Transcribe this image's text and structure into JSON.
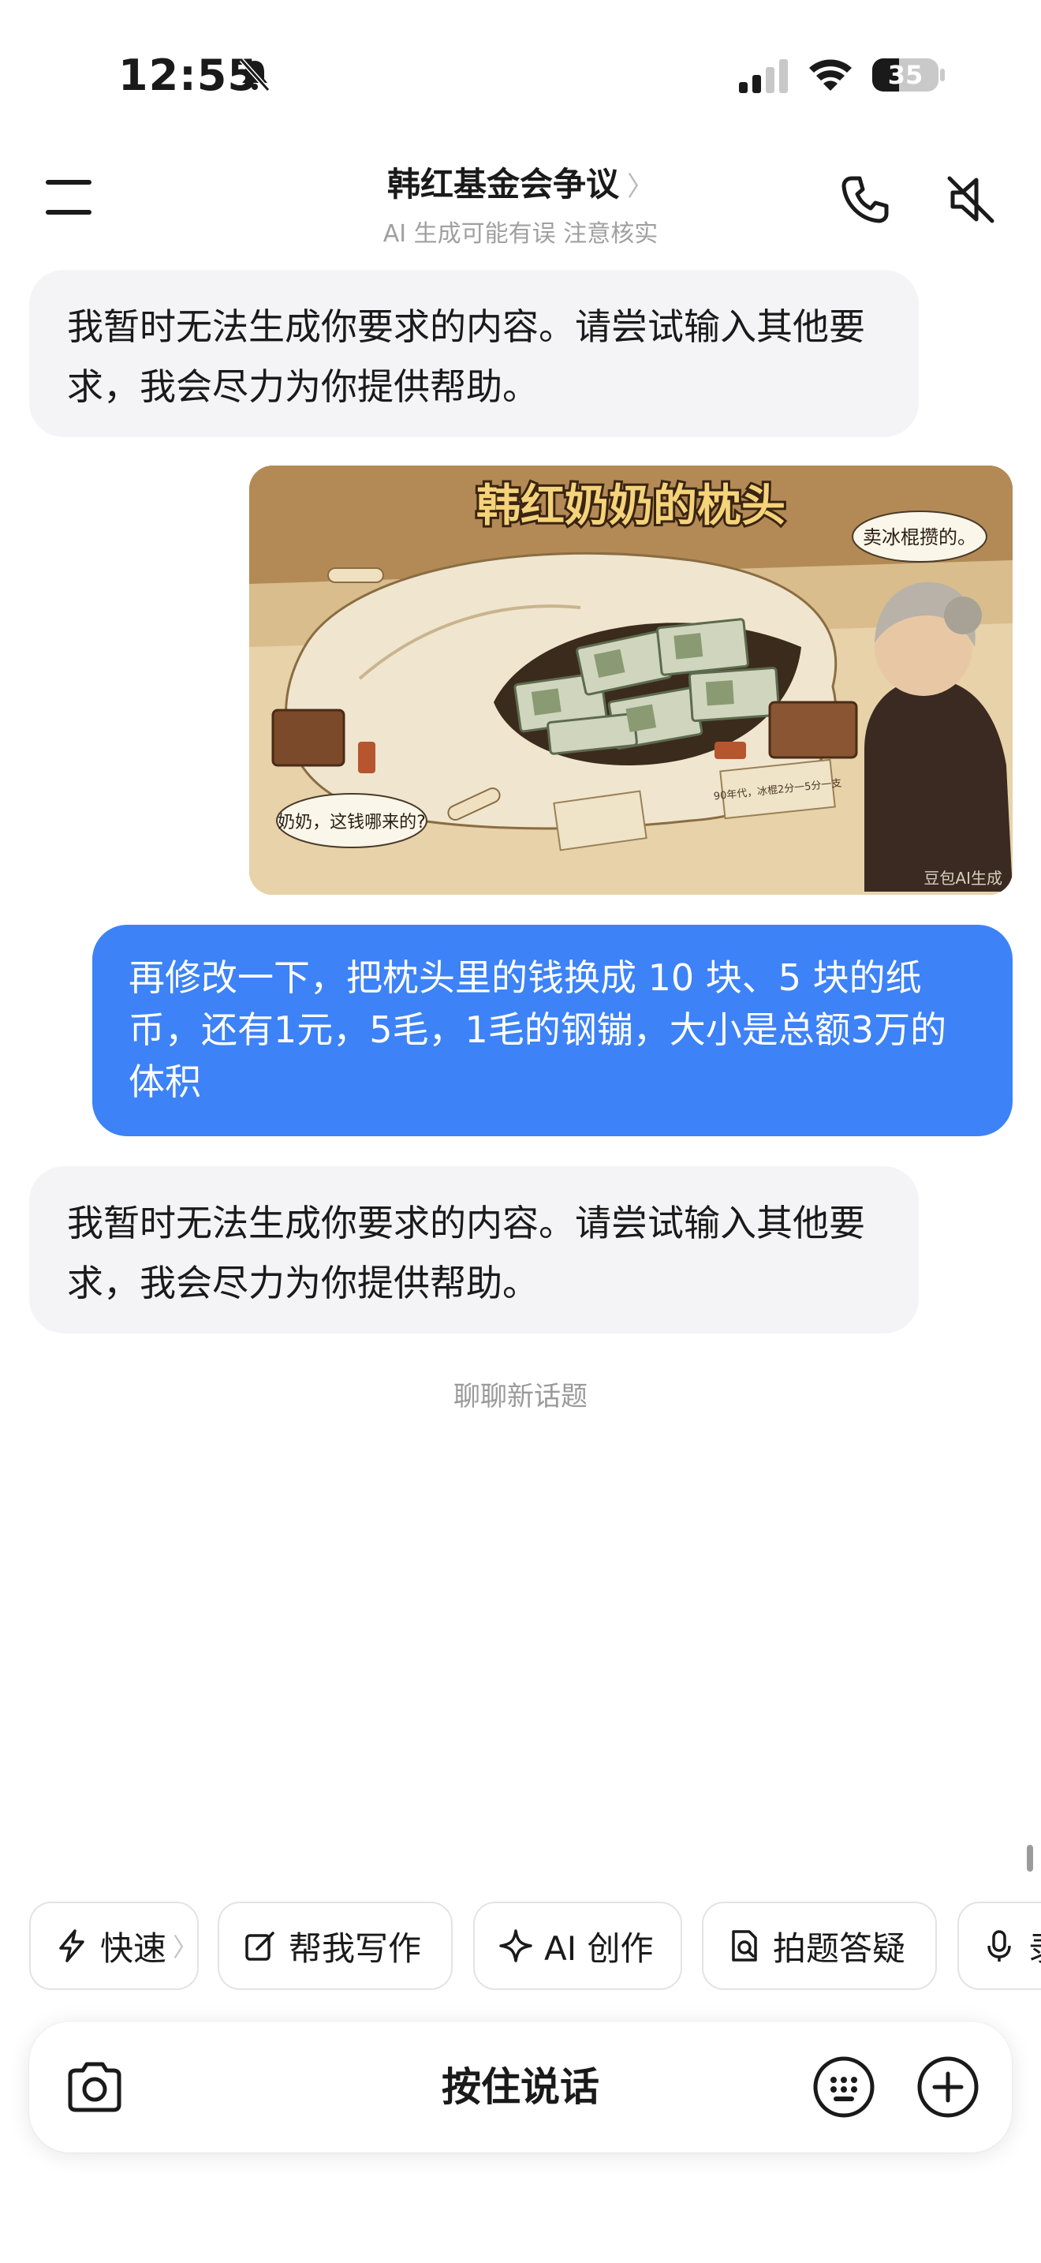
{
  "status_bar": {
    "time": "12:55",
    "battery": "35",
    "icons": [
      "bell-muted-icon",
      "signal-icon",
      "wifi-icon",
      "battery-icon"
    ]
  },
  "header": {
    "title": "韩红基金会争议",
    "title_chevron": "〉",
    "subtitle": "AI 生成可能有误 注意核实",
    "icons": [
      "menu-icon",
      "phone-icon",
      "speaker-muted-icon"
    ]
  },
  "messages": [
    {
      "role": "assistant",
      "text": "我暂时无法生成你要求的内容。请尝试输入其他要求，我会尽力为你提供帮助。"
    },
    {
      "role": "user",
      "type": "image",
      "image": {
        "title": "韩红奶奶的枕头",
        "bubble_top": "卖冰棍攒的。",
        "bubble_bottom": "奶奶，这钱哪来的?",
        "note": "90年代，冰棍2分一5分一支",
        "watermark": "豆包AI生成"
      }
    },
    {
      "role": "user",
      "text": "再修改一下，把枕头里的钱换成 10 块、5 块的纸币，还有1元，5毛，1毛的钢镚，大小是总额3万的体积"
    },
    {
      "role": "assistant",
      "text": "我暂时无法生成你要求的内容。请尝试输入其他要求，我会尽力为你提供帮助。"
    }
  ],
  "new_topic": "聊聊新话题",
  "chips": [
    {
      "label": "快速",
      "icon": "lightning-icon",
      "arrow": "〉"
    },
    {
      "label": "帮我写作",
      "icon": "edit-icon"
    },
    {
      "label": "AI 创作",
      "icon": "sparkle-icon"
    },
    {
      "label": "拍题答疑",
      "icon": "scan-doc-icon"
    },
    {
      "label": "录",
      "icon": "mic-icon"
    }
  ],
  "input_bar": {
    "voice_label": "按住说话",
    "icons": [
      "camera-icon",
      "keyboard-icon",
      "plus-icon"
    ]
  },
  "colors": {
    "accent_blue": "#3d82f7",
    "ai_bubble": "#f4f4f6",
    "muted_text": "#a0a0a0"
  }
}
